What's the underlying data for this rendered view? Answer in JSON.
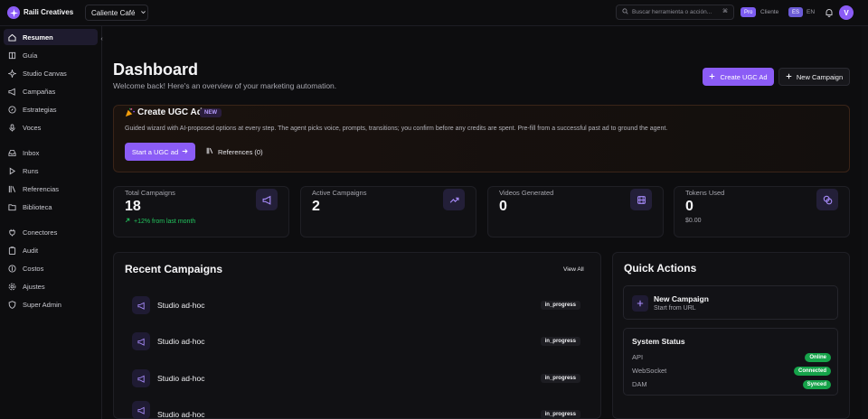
{
  "brand": {
    "name": "Raili Creatives",
    "logo_icon": "sparkle-icon"
  },
  "workspace": {
    "name": "Caliente Café"
  },
  "search": {
    "placeholder": "Buscar herramienta o acción...",
    "shortcut": "⌘"
  },
  "header": {
    "plan": "Pro",
    "role": "Cliente",
    "lang_active": "ES",
    "lang_other": "EN",
    "user_initial": "V"
  },
  "sidebar": {
    "items": [
      {
        "label": "Resumen",
        "icon": "home-icon",
        "active": true
      },
      {
        "label": "Guía",
        "icon": "book-icon"
      },
      {
        "label": "Studio Canvas",
        "icon": "sparkle-icon"
      },
      {
        "label": "Campañas",
        "icon": "megaphone-icon"
      },
      {
        "label": "Estrategias",
        "icon": "compass-icon"
      },
      {
        "label": "Voces",
        "icon": "mic-icon"
      },
      {
        "label": "Inbox",
        "icon": "inbox-icon"
      },
      {
        "label": "Runs",
        "icon": "play-icon"
      },
      {
        "label": "Referencias",
        "icon": "library-icon"
      },
      {
        "label": "Biblioteca",
        "icon": "folder-icon"
      },
      {
        "label": "Conectores",
        "icon": "plug-icon"
      },
      {
        "label": "Audit",
        "icon": "clipboard-icon"
      },
      {
        "label": "Costos",
        "icon": "coin-icon"
      },
      {
        "label": "Ajustes",
        "icon": "gear-icon"
      },
      {
        "label": "Super Admin",
        "icon": "shield-icon"
      }
    ]
  },
  "main": {
    "title": "Dashboard",
    "subtitle": "Welcome back! Here's an overview of your marketing automation.",
    "create_ugc_label": "Create UGC Ad",
    "new_campaign_label": "New Campaign"
  },
  "ugc": {
    "title": "Create UGC Ad",
    "badge": "NEW",
    "description": "Guided wizard with AI-proposed options at every step. The agent picks voice, prompts, transitions; you confirm before any credits are spent. Pre-fill from a successful past ad to ground the agent.",
    "start_label": "Start a UGC ad",
    "references_label": "References (0)"
  },
  "stats": [
    {
      "label": "Total Campaigns",
      "value": "18",
      "sub": "+12% from last month",
      "sub_color": "#22c55e",
      "icon": "megaphone-icon"
    },
    {
      "label": "Active Campaigns",
      "value": "2",
      "sub": "",
      "icon": "trending-up-icon"
    },
    {
      "label": "Videos Generated",
      "value": "0",
      "sub": "",
      "icon": "film-icon"
    },
    {
      "label": "Tokens Used",
      "value": "0",
      "sub": "$0.00",
      "sub_color": "#a6a6ae",
      "icon": "coins-icon"
    }
  ],
  "recent": {
    "title": "Recent Campaigns",
    "view_all": "View All",
    "items": [
      {
        "name": "Studio ad-hoc",
        "status": "in_progress"
      },
      {
        "name": "Studio ad-hoc",
        "status": "in_progress"
      },
      {
        "name": "Studio ad-hoc",
        "status": "in_progress"
      },
      {
        "name": "Studio ad-hoc",
        "status": "in_progress"
      }
    ]
  },
  "quick": {
    "title": "Quick Actions",
    "new_campaign": {
      "title": "New Campaign",
      "subtitle": "Start from URL"
    },
    "system": {
      "title": "System Status",
      "rows": [
        {
          "label": "API",
          "status": "Online"
        },
        {
          "label": "WebSocket",
          "status": "Connected"
        },
        {
          "label": "DAM",
          "status": "Synced"
        }
      ]
    }
  },
  "colors": {
    "accent": "#8b5cf6",
    "success": "#16a34a",
    "background": "#0d0d0f"
  }
}
